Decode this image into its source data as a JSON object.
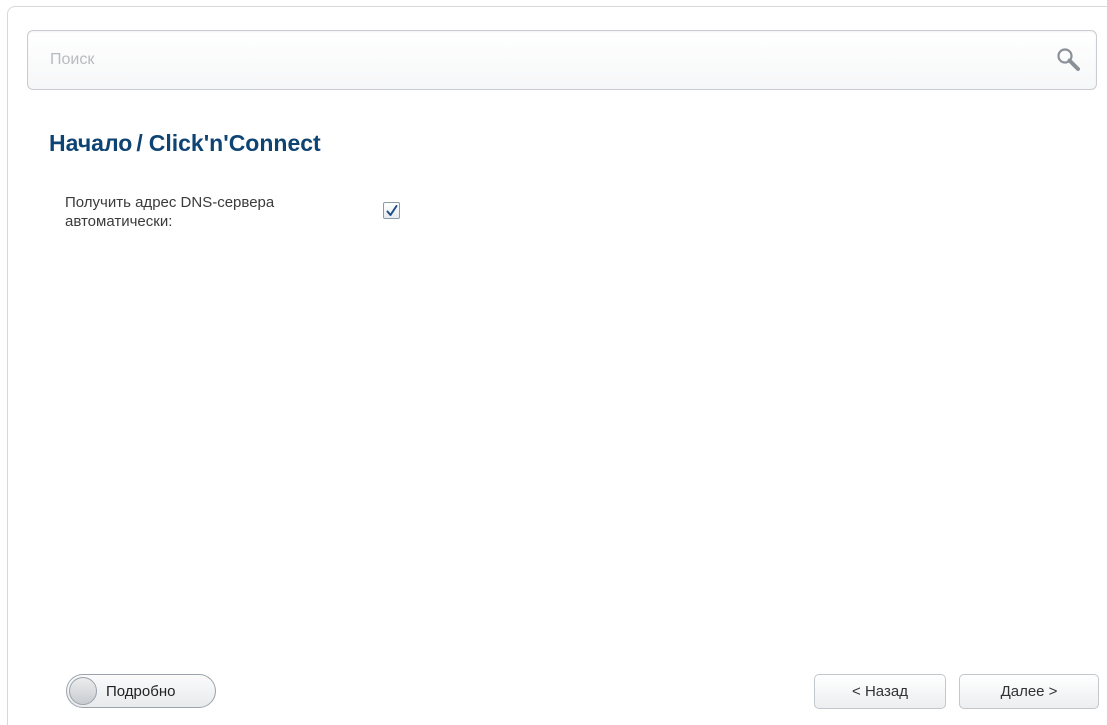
{
  "search": {
    "placeholder": "Поиск",
    "icon": "search-icon"
  },
  "breadcrumb": {
    "home": "Начало",
    "separator": "/",
    "current": "Click'n'Connect"
  },
  "form": {
    "dns_auto": {
      "label": "Получить адрес DNS-сервера автоматически:",
      "checked": true
    }
  },
  "footer": {
    "details_toggle_label": "Подробно",
    "details_toggle_on": false,
    "back_label": "< Назад",
    "next_label": "Далее >"
  },
  "colors": {
    "title": "#0e4473",
    "checkmark": "#1f4f86"
  }
}
